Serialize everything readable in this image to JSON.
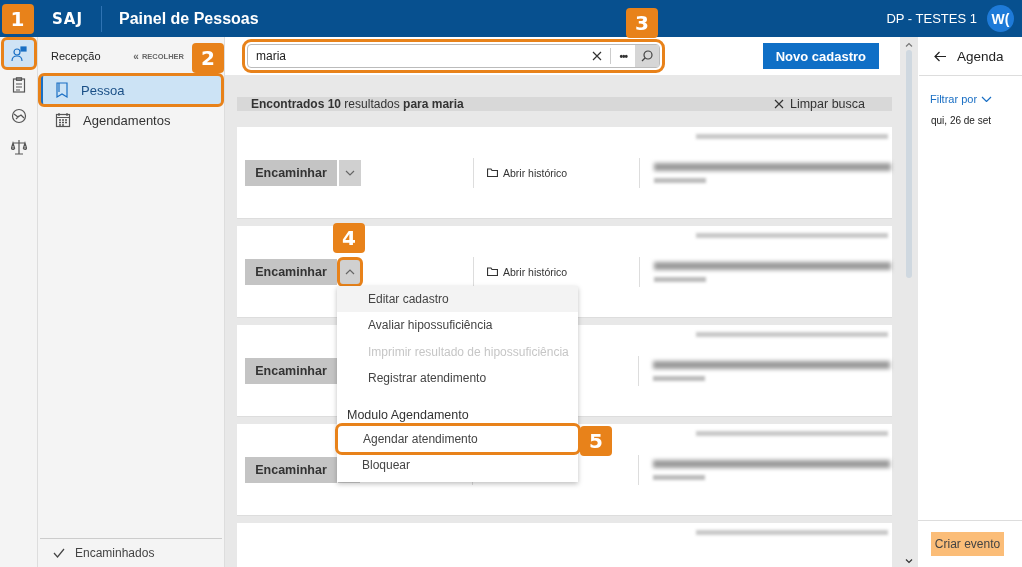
{
  "header": {
    "logo": "SAJ",
    "title": "Painel de Pessoas",
    "org": "DP - TESTES 1",
    "avatar": "W("
  },
  "rail": [
    {
      "selected": true,
      "callout": "1"
    },
    {
      "selected": false
    },
    {
      "selected": false
    },
    {
      "selected": false
    }
  ],
  "sidebar": {
    "title": "Recepção",
    "collapse_icon": "«",
    "collapse": "RECOLHER",
    "items": [
      {
        "label": "Pessoa",
        "selected": true,
        "callout": "2"
      },
      {
        "label": "Agendamentos",
        "selected": false
      }
    ],
    "footer": "Encaminhados"
  },
  "search": {
    "value": "maria",
    "more": "•••",
    "callout": "3"
  },
  "new_button": "Novo cadastro",
  "results": {
    "summary": "**Encontrados 10** resultados **para maria**",
    "clear": "Limpar busca"
  },
  "cards": [
    {
      "kind": "full",
      "action": "Encaminhar",
      "toggle": {
        "expanded": false
      },
      "history": "Abrir histórico"
    },
    {
      "kind": "full",
      "action": "Encaminhar",
      "toggle": {
        "expanded": true,
        "callout": "4"
      },
      "history": "Abrir histórico",
      "menu": [
        {
          "kind": "item",
          "label": "Editar cadastro",
          "highlighted": true,
          "disabled": false
        },
        {
          "kind": "item",
          "label": "Avaliar hipossuficiência",
          "highlighted": false,
          "disabled": false
        },
        {
          "kind": "item",
          "label": "Imprimir resultado de hipossuficiência",
          "highlighted": false,
          "disabled": true
        },
        {
          "kind": "item",
          "label": "Registrar atendimento",
          "highlighted": false,
          "disabled": false
        },
        {
          "kind": "header",
          "label": "Modulo Agendamento"
        },
        {
          "kind": "subitem",
          "label": "Agendar atendimento",
          "highlighted": false,
          "disabled": false,
          "callout": "5"
        },
        {
          "kind": "subitem",
          "label": "Bloquear",
          "highlighted": false,
          "disabled": false
        }
      ]
    },
    {
      "kind": "full",
      "action": "Encaminhar"
    },
    {
      "kind": "full",
      "action": "Encaminhar",
      "toggle": true
    },
    {
      "kind": "partial"
    }
  ],
  "agenda": {
    "title": "Agenda",
    "filter": "Filtrar por",
    "date": "qui, 26 de set",
    "button": "Criar evento"
  }
}
